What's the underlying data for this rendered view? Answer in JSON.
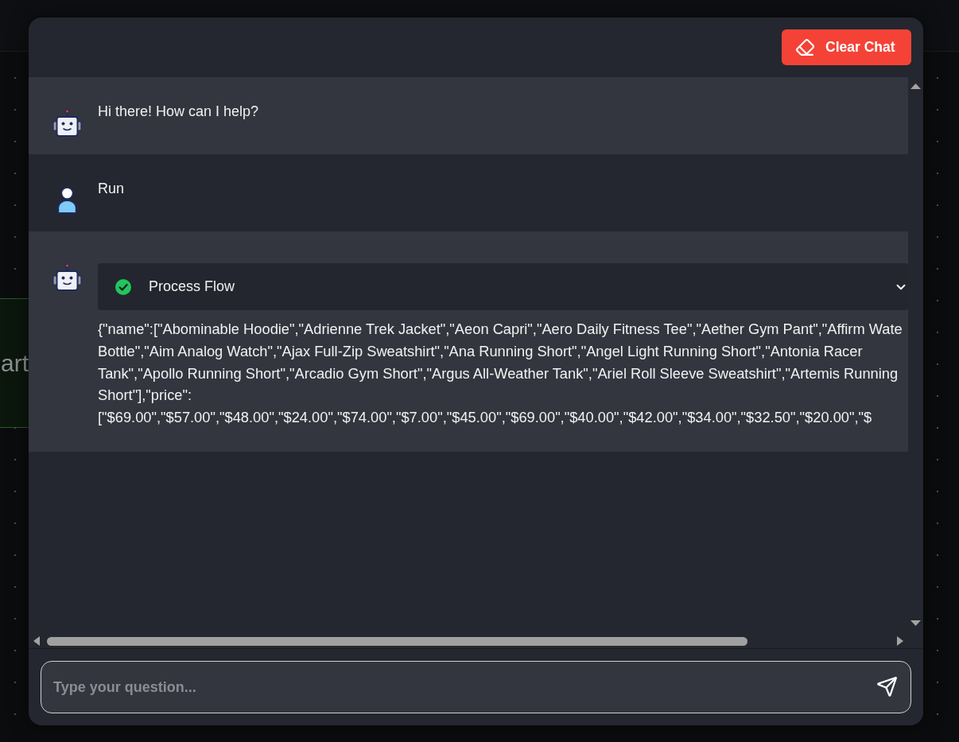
{
  "canvas": {
    "node": {
      "label": "art"
    }
  },
  "chat": {
    "clear_button": {
      "label": "Clear Chat"
    },
    "messages": [
      {
        "kind": "bot",
        "text": "Hi there! How can I help?"
      },
      {
        "kind": "user",
        "text": "Run"
      },
      {
        "kind": "bot",
        "process": {
          "title": "Process Flow",
          "completed": true,
          "expanded": false
        },
        "output_lines": [
          "{\"name\":[\"Abominable Hoodie\",\"Adrienne Trek Jacket\",\"Aeon Capri\",\"Aero Daily Fitness Tee\",\"Aether Gym Pant\",\"Affirm Wate",
          "Bottle\",\"Aim Analog Watch\",\"Ajax Full-Zip Sweatshirt\",\"Ana Running Short\",\"Angel Light Running Short\",\"Antonia Racer",
          "Tank\",\"Apollo Running Short\",\"Arcadio Gym Short\",\"Argus All-Weather Tank\",\"Ariel Roll Sleeve Sweatshirt\",\"Artemis Running",
          "Short\"],\"price\":",
          "[\"$69.00\",\"$57.00\",\"$48.00\",\"$24.00\",\"$74.00\",\"$7.00\",\"$45.00\",\"$69.00\",\"$40.00\",\"$42.00\",\"$34.00\",\"$32.50\",\"$20.00\",\"$"
        ]
      }
    ],
    "input": {
      "placeholder": "Type your question..."
    }
  }
}
